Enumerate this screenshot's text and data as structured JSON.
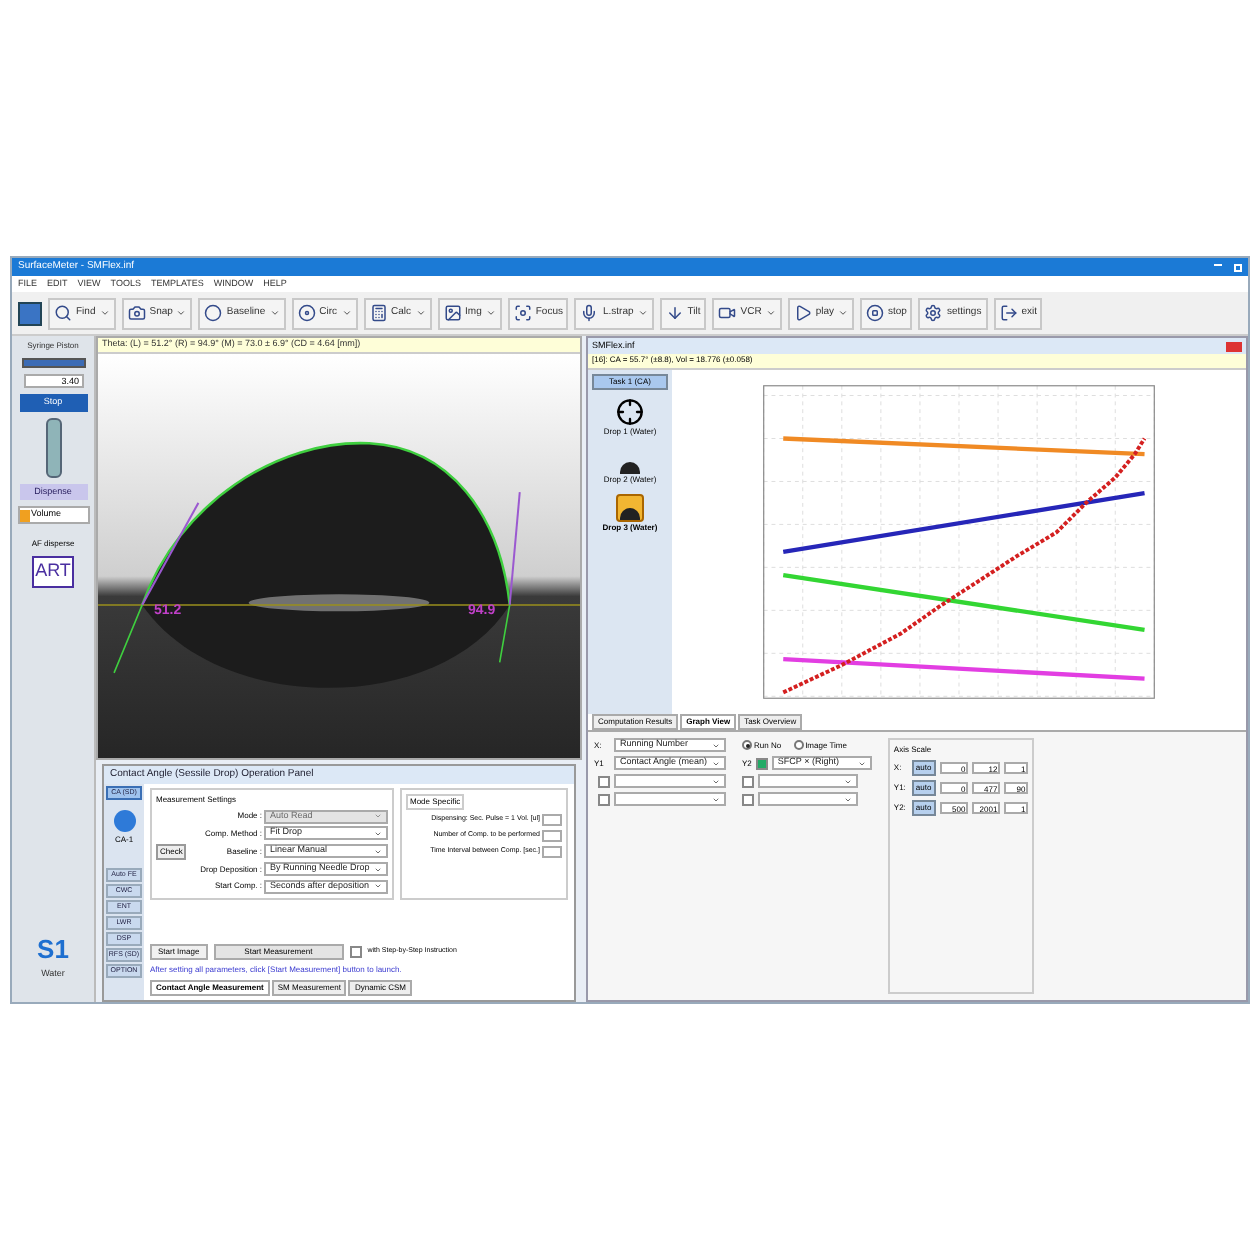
{
  "window": {
    "title": "SurfaceMeter - SMFlex.inf"
  },
  "menu": [
    "FILE",
    "EDIT",
    "VIEW",
    "TOOLS",
    "TEMPLATES",
    "WINDOW",
    "HELP"
  ],
  "toolbar": [
    {
      "label": "Find",
      "kind": "dropdown"
    },
    {
      "label": "Snap",
      "kind": "dropdown"
    },
    {
      "label": "Baseline",
      "kind": "dropdown"
    },
    {
      "label": "Circ",
      "kind": "dropdown"
    },
    {
      "label": "Calc",
      "kind": "dropdown"
    },
    {
      "label": "Img",
      "kind": "dropdown"
    },
    {
      "label": "Focus",
      "kind": "button"
    },
    {
      "label": "L.strap",
      "kind": "dropdown"
    },
    {
      "label": "Tilt",
      "kind": "button"
    },
    {
      "label": "VCR",
      "kind": "dropdown"
    },
    {
      "label": "play",
      "kind": "dropdown"
    },
    {
      "label": "stop",
      "kind": "button"
    },
    {
      "label": "settings",
      "kind": "button"
    },
    {
      "label": "exit",
      "kind": "button"
    }
  ],
  "side_panel": {
    "header": "Syringe Piston",
    "volume_label": "Volume",
    "stop_button": "Stop",
    "dispense_button": "Dispense",
    "value": "3.40",
    "disperse_label": "AF disperse",
    "logo": "ART",
    "liquid_code": "S1",
    "liquid_name": "Water"
  },
  "image_view": {
    "info": "Theta: (L) = 51.2° (R) = 94.9° (M) = 73.0 ± 6.9° (CD = 4.64 [mm])",
    "left_angle": "51.2",
    "right_angle": "94.9"
  },
  "operation_panel": {
    "title": "Contact Angle (Sessile Drop) Operation Panel",
    "side_buttons": [
      {
        "label": "CA (SD)",
        "selected": true
      },
      {
        "label": "Auto FE",
        "selected": false
      },
      {
        "label": "CWC",
        "selected": false
      },
      {
        "label": "ENT",
        "selected": false
      },
      {
        "label": "LWR",
        "selected": false
      },
      {
        "label": "DSP",
        "selected": false
      },
      {
        "label": "RFS (SD)",
        "selected": false
      },
      {
        "label": "OPTION",
        "selected": false
      }
    ],
    "device_label": "CA-1",
    "settings_title": "Measurement Settings",
    "settings": [
      {
        "label": "Mode :",
        "value": "Auto Read",
        "disabled": true
      },
      {
        "label": "Comp. Method :",
        "value": "Fit Drop",
        "disabled": false
      },
      {
        "label": "Baseline :",
        "value": "Linear Manual",
        "disabled": false
      },
      {
        "label": "Drop Deposition :",
        "value": "By Running Needle Drop",
        "disabled": false
      },
      {
        "label": "Start Comp. :",
        "value": "Seconds after deposition",
        "disabled": false
      }
    ],
    "check_button": "Check",
    "mode_tab": "Mode Specific",
    "mode_fields": [
      {
        "label": "Dispensing: Sec. Pulse = 1",
        "suffix": "Vol. [ul]"
      },
      {
        "label": "Number of Comp. to be performed"
      },
      {
        "label": "Time Interval between Comp. [sec.]"
      }
    ],
    "start_image": "Start Image",
    "start_measurement": "Start Measurement",
    "step_option": {
      "label": "with Step-by-Step Instruction",
      "checked": false
    },
    "hint": "After setting all parameters, click [Start Measurement] button to launch.",
    "tabs": [
      {
        "label": "Contact Angle Measurement",
        "selected": true
      },
      {
        "label": "SM Measurement",
        "selected": false
      },
      {
        "label": "Dynamic CSM",
        "selected": false
      }
    ]
  },
  "graph_window": {
    "title": "SMFlex.inf",
    "info": "[16]: CA = 55.7° (±8.8), Vol = 18.776 (±0.058)",
    "task": "Task 1 (CA)",
    "drops": [
      {
        "label": "Drop 1 (Water)",
        "selected": false
      },
      {
        "label": "Drop 2 (Water)",
        "selected": false
      },
      {
        "label": "Drop 3 (Water)",
        "selected": true
      }
    ],
    "tabs": [
      {
        "label": "Computation Results",
        "selected": false
      },
      {
        "label": "Graph View",
        "selected": true
      },
      {
        "label": "Task Overview",
        "selected": false
      }
    ],
    "x_label": "X:",
    "x_value": "Running Number",
    "x_modes": [
      {
        "label": "Run No",
        "selected": true
      },
      {
        "label": "Image Time",
        "selected": false
      }
    ],
    "y1_label": "Y1",
    "y1_rows": [
      {
        "value": "Contact Angle (mean)"
      },
      {
        "checked": false
      },
      {
        "checked": false
      }
    ],
    "y2_label": "Y2",
    "y2_rows": [
      {
        "value": "SFCP × (Right)",
        "checked": true
      },
      {
        "checked": false
      },
      {
        "checked": false
      }
    ],
    "axis_title": "Axis Scale",
    "axes": [
      {
        "label": "X:",
        "auto": "auto",
        "min": "0",
        "max": "12",
        "step": "1"
      },
      {
        "label": "Y1:",
        "auto": "auto",
        "min": "0",
        "max": "477",
        "step": "90"
      },
      {
        "label": "Y2:",
        "auto": "auto",
        "min": "500",
        "max": "2001",
        "step": "1"
      }
    ]
  }
}
